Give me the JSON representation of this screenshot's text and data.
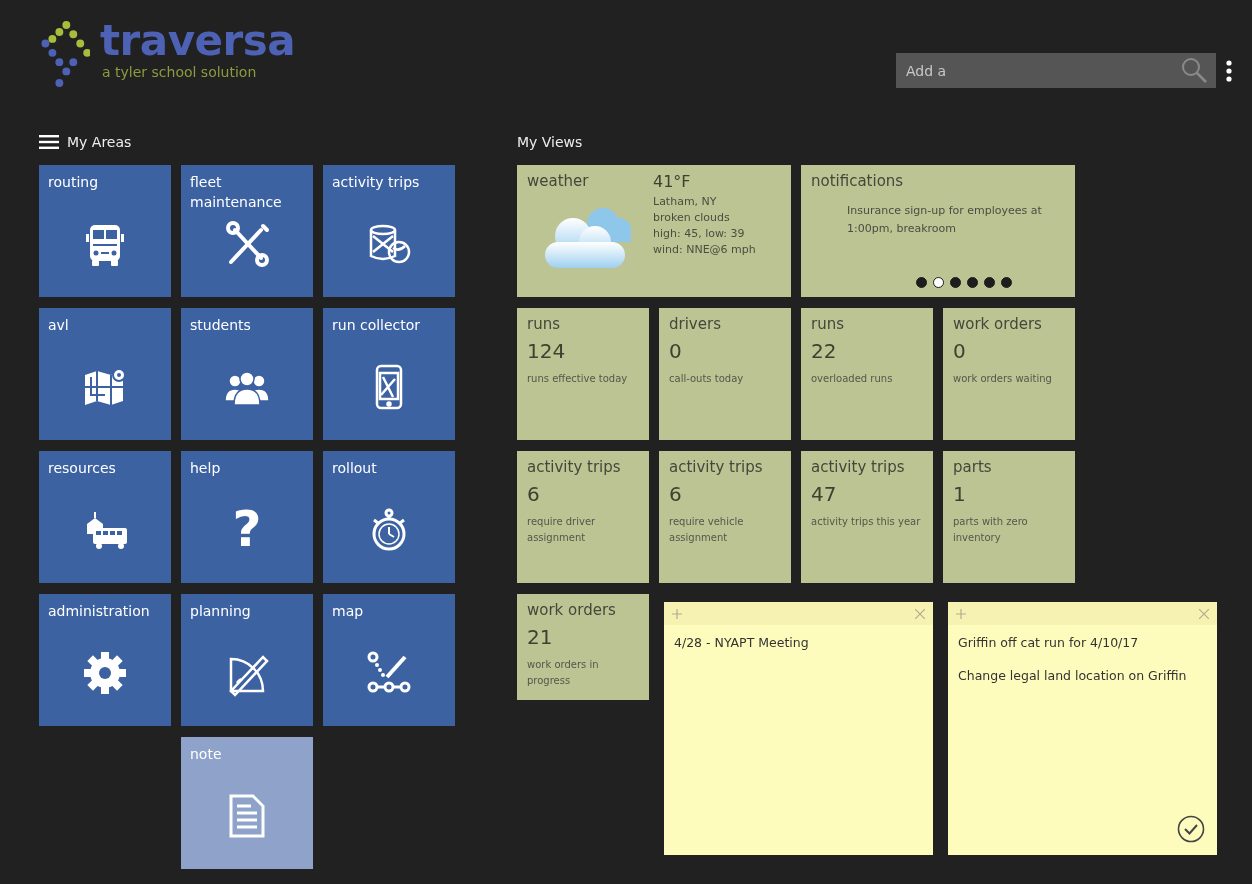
{
  "logo": {
    "name": "traversa",
    "tagline": "a tyler school solution"
  },
  "search": {
    "placeholder": "Add a"
  },
  "areas": {
    "title": "My Areas",
    "tiles": [
      {
        "label": "routing",
        "kind": "bus",
        "disabled": false
      },
      {
        "label": "fleet maintenance",
        "kind": "tools",
        "disabled": false
      },
      {
        "label": "activity trips",
        "kind": "drum",
        "disabled": false
      },
      {
        "label": "avl",
        "kind": "map",
        "disabled": false
      },
      {
        "label": "students",
        "kind": "people",
        "disabled": false
      },
      {
        "label": "run collector",
        "kind": "phone",
        "disabled": false
      },
      {
        "label": "resources",
        "kind": "school",
        "disabled": false
      },
      {
        "label": "help",
        "kind": "glyph",
        "glyph": "?",
        "disabled": false
      },
      {
        "label": "rollout",
        "kind": "stopwatch",
        "disabled": false
      },
      {
        "label": "administration",
        "kind": "gear",
        "disabled": false
      },
      {
        "label": "planning",
        "kind": "compass",
        "disabled": false
      },
      {
        "label": "map",
        "kind": "route",
        "disabled": false
      },
      {
        "label": "note",
        "kind": "document",
        "disabled": true
      }
    ]
  },
  "views": {
    "title": "My Views",
    "weather": {
      "title": "weather",
      "temperature": "41°F",
      "lines": [
        "Latham, NY",
        "broken clouds",
        "high: 45, low: 39",
        "wind: NNE@6 mph"
      ]
    },
    "notifications": {
      "title": "notifications",
      "message": "Insurance sign-up for employees at 1:00pm, breakroom",
      "pages": [
        {
          "selected": false
        },
        {
          "selected": true
        },
        {
          "selected": false
        },
        {
          "selected": false
        },
        {
          "selected": false
        },
        {
          "selected": false
        }
      ]
    },
    "counters": [
      {
        "title": "runs",
        "value": "124",
        "caption": "runs effective today"
      },
      {
        "title": "drivers",
        "value": "0",
        "caption": "call-outs today"
      },
      {
        "title": "runs",
        "value": "22",
        "caption": "overloaded runs"
      },
      {
        "title": "work orders",
        "value": "0",
        "caption": "work orders waiting"
      },
      {
        "title": "activity trips",
        "value": "6",
        "caption": "require driver assignment"
      },
      {
        "title": "activity trips",
        "value": "6",
        "caption": "require vehicle assignment"
      },
      {
        "title": "activity trips",
        "value": "47",
        "caption": "activity trips this year"
      },
      {
        "title": "parts",
        "value": "1",
        "caption": "parts with zero inventory"
      },
      {
        "title": "work orders",
        "value": "21",
        "caption": "work orders in progress"
      }
    ],
    "sticky_notes": [
      {
        "lines": [
          "4/28 - NYAPT Meeting"
        ],
        "done_button": false
      },
      {
        "lines": [
          "Griffin off cat run for 4/10/17",
          "Change legal land location on Griffin"
        ],
        "done_button": true
      }
    ]
  }
}
